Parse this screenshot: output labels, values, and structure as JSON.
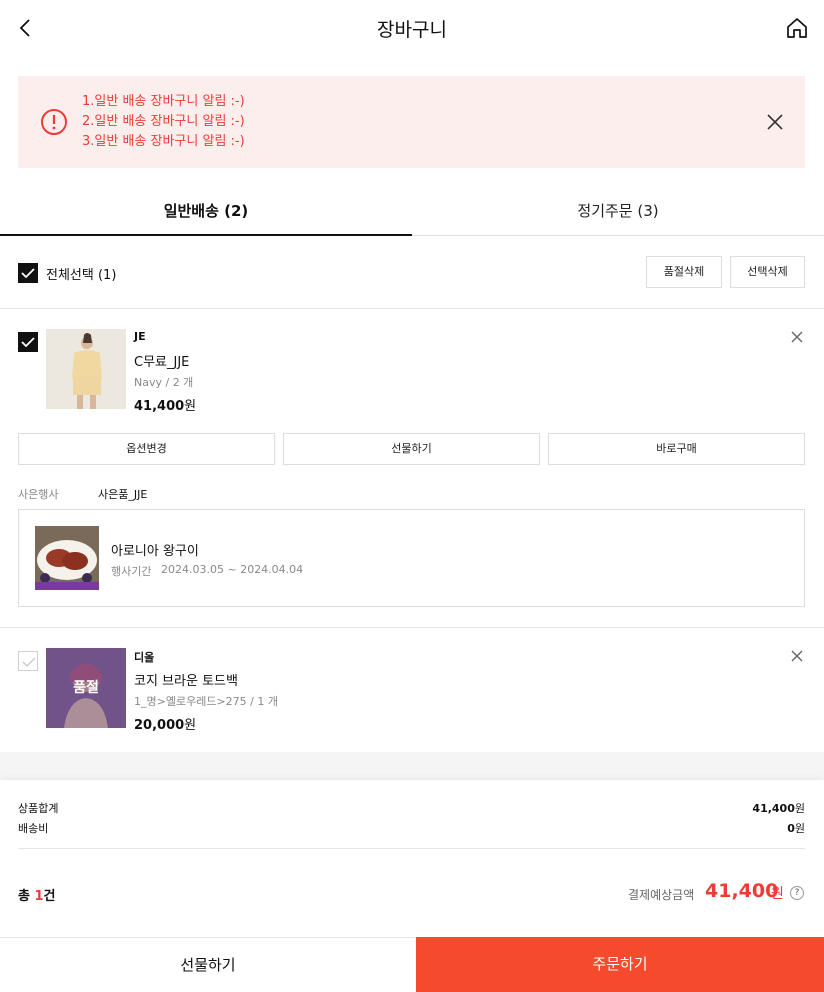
{
  "header": {
    "title": "장바구니",
    "back_icon": "chevron-left-icon",
    "home_icon": "home-icon"
  },
  "alert": {
    "lines": [
      "1.일반 배송 장바구니 알림 :-)",
      "2.일반 배송 장바구니 알림 :-)",
      "3.일반 배송 장바구니 알림 :-)"
    ],
    "color": "#ef3b36",
    "background": "#fdeeee"
  },
  "tabs": [
    {
      "label": "일반배송 (2)",
      "active": true
    },
    {
      "label": "정기주문 (3)",
      "active": false
    }
  ],
  "select_bar": {
    "select_all_label": "전체선택 (1)",
    "select_all_checked": true,
    "delete_soldout_label": "품절삭제",
    "delete_selected_label": "선택삭제"
  },
  "items": [
    {
      "checked": true,
      "brand": "JE",
      "name": "C무료_JJE",
      "option": "Navy / 2 개",
      "price": "41,400",
      "currency": "원",
      "actions": [
        "옵션변경",
        "선물하기",
        "바로구매"
      ],
      "gift_event": {
        "label": "사은행사",
        "gift_name": "사은품_JJE",
        "title": "아로니아 왕구이",
        "period_label": "행사기간",
        "period": "2024.03.05 ~ 2024.04.04"
      }
    },
    {
      "checked": false,
      "soldout_label": "품절",
      "brand": "디올",
      "name": "코지 브라운 토드백",
      "option": "1_명>옐로우레드>275 / 1 개",
      "price": "20,000",
      "currency": "원"
    }
  ],
  "summary": {
    "product_total_label": "상품합계",
    "product_total_value": "41,400",
    "shipping_label": "배송비",
    "shipping_value": "0",
    "currency": "원",
    "total_prefix": "총",
    "total_count": "1",
    "total_suffix": "건",
    "pay_label": "결제예상금액",
    "pay_amount": "41,400",
    "help_label": "?"
  },
  "bottom": {
    "gift_label": "선물하기",
    "order_label": "주문하기",
    "order_color": "#f64a2e"
  }
}
